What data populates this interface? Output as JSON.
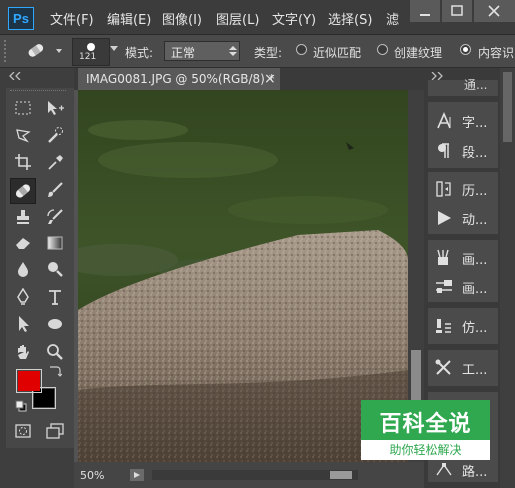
{
  "app": {
    "logo": "Ps"
  },
  "menu": [
    "文件(F)",
    "编辑(E)",
    "图像(I)",
    "图层(L)",
    "文字(Y)",
    "选择(S)",
    "滤"
  ],
  "options": {
    "brush_size": "121",
    "mode_label": "模式:",
    "mode_value": "正常",
    "type_label": "类型:",
    "type_options": [
      "近似匹配",
      "创建纹理",
      "内容识"
    ],
    "selected_type": 2
  },
  "document": {
    "tab_title": "IMAG0081.JPG @ 50%(RGB/8) *",
    "close": "×",
    "zoom": "50%"
  },
  "colors": {
    "foreground": "#e00000",
    "background": "#000000",
    "accent": "#31a8ff"
  },
  "panels": {
    "items": [
      {
        "icon": "character-icon",
        "label": "字..."
      },
      {
        "icon": "paragraph-icon",
        "label": "段..."
      },
      {
        "icon": "history-icon",
        "label": "历..."
      },
      {
        "icon": "actions-icon",
        "label": "动..."
      },
      {
        "icon": "brush-presets-icon",
        "label": "画..."
      },
      {
        "icon": "brush-settings-icon",
        "label": "画..."
      },
      {
        "icon": "clone-source-icon",
        "label": "仿..."
      },
      {
        "icon": "tool-presets-icon",
        "label": "工..."
      }
    ],
    "top_label": "通...",
    "bottom_label": "路..."
  },
  "watermark": {
    "title": "百科全说",
    "subtitle": "助你轻松解决"
  }
}
